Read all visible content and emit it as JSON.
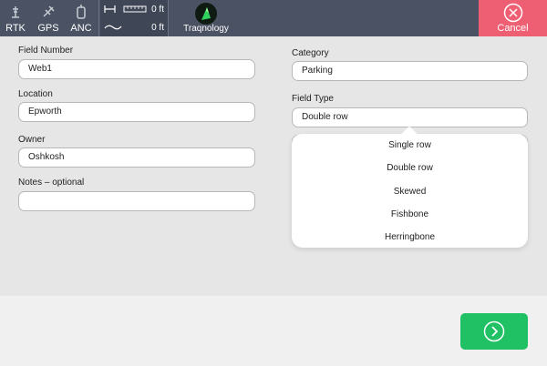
{
  "topbar": {
    "rtk_label": "RTK",
    "gps_label": "GPS",
    "anc_label": "ANC",
    "distance_value": "0 ft",
    "area_value": "0 ft",
    "brand_label": "Traqnology",
    "cancel_label": "Cancel"
  },
  "form": {
    "field_number": {
      "label": "Field Number",
      "value": "Web1"
    },
    "location": {
      "label": "Location",
      "value": "Epworth"
    },
    "owner": {
      "label": "Owner",
      "value": "Oshkosh"
    },
    "notes": {
      "label": "Notes – optional",
      "value": ""
    },
    "category": {
      "label": "Category",
      "value": "Parking"
    },
    "field_type": {
      "label": "Field Type",
      "value": "Double row"
    }
  },
  "dropdown": {
    "options": [
      "Single row",
      "Double row",
      "Skewed",
      "Fishbone",
      "Herringbone"
    ]
  },
  "colors": {
    "topbar": "#4a5263",
    "cancel": "#ef5f73",
    "next": "#20c064"
  }
}
